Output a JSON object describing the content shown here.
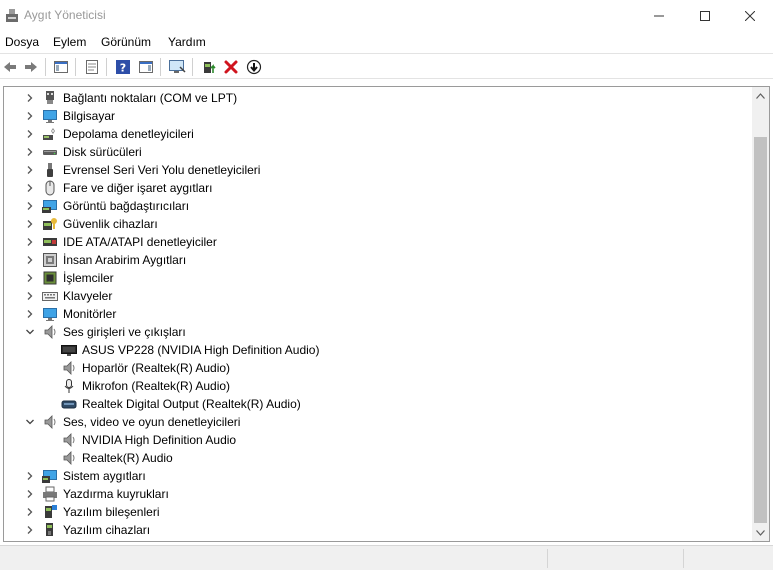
{
  "window": {
    "title": "Aygıt Yöneticisi"
  },
  "menu": [
    "Dosya",
    "Eylem",
    "Görünüm",
    "Yardım"
  ],
  "toolbar": [
    {
      "name": "back-button",
      "icon": "arrow-left-icon"
    },
    {
      "name": "forward-button",
      "icon": "arrow-right-icon"
    },
    {
      "name": "show-hide-console-tree-button",
      "icon": "console-tree-icon"
    },
    {
      "name": "properties-button",
      "icon": "properties-icon"
    },
    {
      "name": "help-button",
      "icon": "help-icon"
    },
    {
      "name": "action-pane-button",
      "icon": "action-pane-icon"
    },
    {
      "name": "scan-hardware-button",
      "icon": "monitor-scan-icon"
    },
    {
      "name": "update-driver-button",
      "icon": "update-driver-icon"
    },
    {
      "name": "uninstall-device-button",
      "icon": "red-x-icon"
    },
    {
      "name": "disable-device-button",
      "icon": "down-arrow-circle-icon"
    }
  ],
  "tree": [
    {
      "label": "Bağlantı noktaları (COM ve LPT)",
      "icon": "port-icon",
      "level": 0,
      "state": "collapsed"
    },
    {
      "label": "Bilgisayar",
      "icon": "computer-icon",
      "level": 0,
      "state": "collapsed"
    },
    {
      "label": "Depolama denetleyicileri",
      "icon": "storage-controller-icon",
      "level": 0,
      "state": "collapsed"
    },
    {
      "label": "Disk sürücüleri",
      "icon": "disk-drive-icon",
      "level": 0,
      "state": "collapsed"
    },
    {
      "label": "Evrensel Seri Veri Yolu denetleyicileri",
      "icon": "usb-icon",
      "level": 0,
      "state": "collapsed"
    },
    {
      "label": "Fare ve diğer işaret aygıtları",
      "icon": "mouse-icon",
      "level": 0,
      "state": "collapsed"
    },
    {
      "label": "Görüntü bağdaştırıcıları",
      "icon": "display-adapter-icon",
      "level": 0,
      "state": "collapsed"
    },
    {
      "label": "Güvenlik cihazları",
      "icon": "security-device-icon",
      "level": 0,
      "state": "collapsed"
    },
    {
      "label": "IDE ATA/ATAPI denetleyiciler",
      "icon": "ide-controller-icon",
      "level": 0,
      "state": "collapsed"
    },
    {
      "label": "İnsan Arabirim Aygıtları",
      "icon": "hid-icon",
      "level": 0,
      "state": "collapsed"
    },
    {
      "label": "İşlemciler",
      "icon": "processor-icon",
      "level": 0,
      "state": "collapsed"
    },
    {
      "label": "Klavyeler",
      "icon": "keyboard-icon",
      "level": 0,
      "state": "collapsed"
    },
    {
      "label": "Monitörler",
      "icon": "monitor-icon",
      "level": 0,
      "state": "collapsed"
    },
    {
      "label": "Ses girişleri ve çıkışları",
      "icon": "speaker-icon",
      "level": 0,
      "state": "expanded"
    },
    {
      "label": "ASUS VP228 (NVIDIA High Definition Audio)",
      "icon": "monitor-dark-icon",
      "level": 1,
      "state": "none"
    },
    {
      "label": "Hoparlör (Realtek(R) Audio)",
      "icon": "speaker-icon",
      "level": 1,
      "state": "none"
    },
    {
      "label": "Mikrofon (Realtek(R) Audio)",
      "icon": "microphone-icon",
      "level": 1,
      "state": "none"
    },
    {
      "label": "Realtek Digital Output (Realtek(R) Audio)",
      "icon": "digital-output-icon",
      "level": 1,
      "state": "none"
    },
    {
      "label": "Ses, video ve oyun denetleyicileri",
      "icon": "speaker-icon",
      "level": 0,
      "state": "expanded"
    },
    {
      "label": "NVIDIA High Definition Audio",
      "icon": "speaker-icon",
      "level": 1,
      "state": "none"
    },
    {
      "label": "Realtek(R) Audio",
      "icon": "speaker-icon",
      "level": 1,
      "state": "none"
    },
    {
      "label": "Sistem aygıtları",
      "icon": "system-device-icon",
      "level": 0,
      "state": "collapsed"
    },
    {
      "label": "Yazdırma kuyrukları",
      "icon": "printer-icon",
      "level": 0,
      "state": "collapsed"
    },
    {
      "label": "Yazılım bileşenleri",
      "icon": "software-component-icon",
      "level": 0,
      "state": "collapsed"
    },
    {
      "label": "Yazılım cihazları",
      "icon": "software-device-icon",
      "level": 0,
      "state": "collapsed"
    }
  ]
}
